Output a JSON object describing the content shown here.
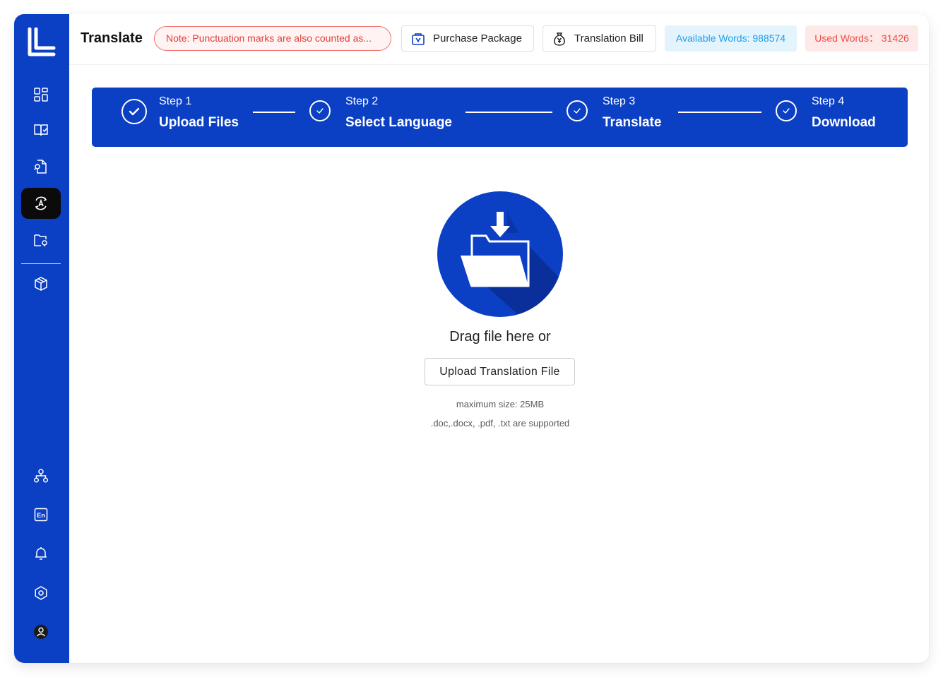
{
  "header": {
    "title": "Translate",
    "note": "Note: Punctuation marks are also counted as...",
    "purchase_label": "Purchase Package",
    "bill_label": "Translation Bill",
    "available_words": "Available Words: 988574",
    "used_words": "Used Words： 31426"
  },
  "sidebar": {
    "items": [
      {
        "icon": "dashboard-grid-icon"
      },
      {
        "icon": "book-icon"
      },
      {
        "icon": "document-search-icon"
      },
      {
        "icon": "translate-icon",
        "active": true
      },
      {
        "icon": "folder-location-icon"
      },
      {
        "icon": "package-box-icon"
      },
      {
        "icon": "org-chart-icon"
      },
      {
        "icon": "language-en-icon"
      },
      {
        "icon": "bell-icon"
      },
      {
        "icon": "settings-gear-icon"
      },
      {
        "icon": "user-avatar-icon"
      }
    ]
  },
  "steps": [
    {
      "step": "Step 1",
      "label": "Upload Files"
    },
    {
      "step": "Step 2",
      "label": "Select Language"
    },
    {
      "step": "Step 3",
      "label": "Translate"
    },
    {
      "step": "Step 4",
      "label": "Download"
    }
  ],
  "upload": {
    "drag_text": "Drag file here or",
    "button_label": "Upload Translation File",
    "max_size": "maximum size: 25MB",
    "supported": ".doc,.docx, .pdf, .txt are supported"
  },
  "colors": {
    "brand_blue": "#0b3fc4",
    "note_red": "#e03d37",
    "available_blue": "#1f9ee8",
    "used_red": "#ee4b44"
  }
}
